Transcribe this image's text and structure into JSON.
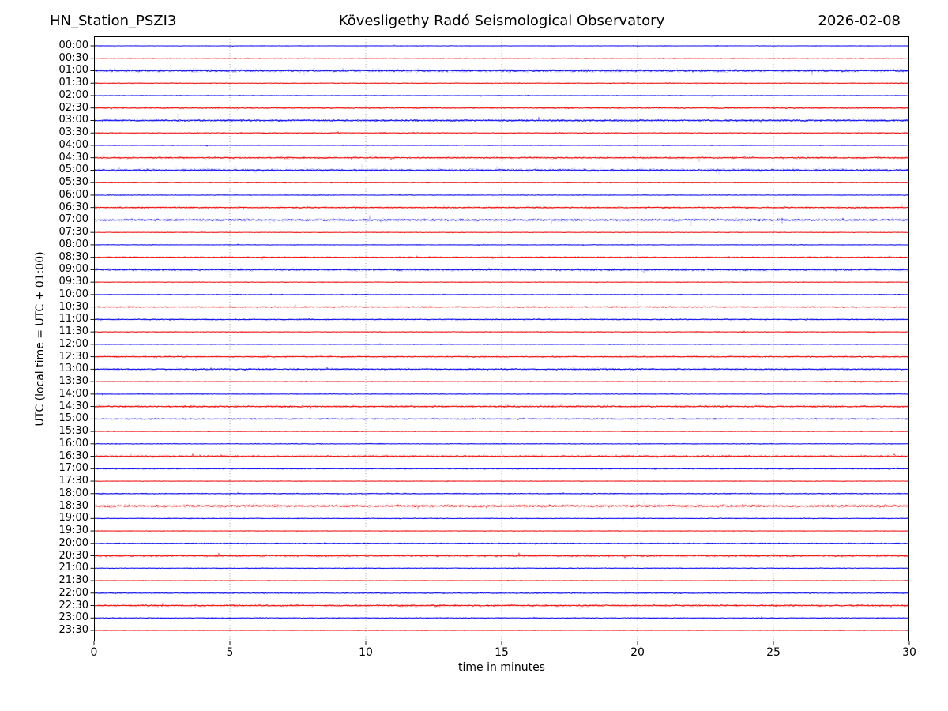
{
  "chart_data": {
    "type": "line",
    "subtype": "helicorder-dayplot",
    "title_left": "HN_Station_PSZI3",
    "title_center": "Kövesligethy Radó Seismological Observatory",
    "title_right": "2026-02-08",
    "ylabel": "UTC (local time = UTC + 01:00)",
    "xlabel": "time in minutes",
    "xlim": [
      0,
      30
    ],
    "x_ticks": [
      0,
      5,
      10,
      15,
      20,
      25,
      30
    ],
    "grid_vertical_minutes": [
      5,
      10,
      15,
      20,
      25
    ],
    "grid_style": "dotted gray vertical lines, no horizontal grid",
    "minutes_per_row": 30,
    "colors": {
      "blue": "#0000ee",
      "red": "#ee0000",
      "grid": "#666666",
      "frame": "#000000"
    },
    "rows": [
      {
        "t": "00:00",
        "c": "blue",
        "a": 0.55
      },
      {
        "t": "00:30",
        "c": "red",
        "a": 0.75
      },
      {
        "t": "01:00",
        "c": "blue",
        "a": 1.9
      },
      {
        "t": "01:30",
        "c": "red",
        "a": 0.75
      },
      {
        "t": "02:00",
        "c": "blue",
        "a": 0.65
      },
      {
        "t": "02:30",
        "c": "red",
        "a": 1.25
      },
      {
        "t": "03:00",
        "c": "blue",
        "a": 1.9
      },
      {
        "t": "03:30",
        "c": "red",
        "a": 0.85
      },
      {
        "t": "04:00",
        "c": "blue",
        "a": 0.65
      },
      {
        "t": "04:30",
        "c": "red",
        "a": 1.45
      },
      {
        "t": "05:00",
        "c": "blue",
        "a": 1.9
      },
      {
        "t": "05:30",
        "c": "red",
        "a": 0.75
      },
      {
        "t": "06:00",
        "c": "blue",
        "a": 0.75
      },
      {
        "t": "06:30",
        "c": "red",
        "a": 1.35
      },
      {
        "t": "07:00",
        "c": "blue",
        "a": 1.7
      },
      {
        "t": "07:30",
        "c": "red",
        "a": 0.65
      },
      {
        "t": "08:00",
        "c": "blue",
        "a": 0.65
      },
      {
        "t": "08:30",
        "c": "red",
        "a": 1.15
      },
      {
        "t": "09:00",
        "c": "blue",
        "a": 1.7
      },
      {
        "t": "09:30",
        "c": "red",
        "a": 0.65
      },
      {
        "t": "10:00",
        "c": "blue",
        "a": 0.75
      },
      {
        "t": "10:30",
        "c": "red",
        "a": 1.15
      },
      {
        "t": "11:00",
        "c": "blue",
        "a": 1.15
      },
      {
        "t": "11:30",
        "c": "red",
        "a": 0.75
      },
      {
        "t": "12:00",
        "c": "blue",
        "a": 0.65
      },
      {
        "t": "12:30",
        "c": "red",
        "a": 1.25
      },
      {
        "t": "13:00",
        "c": "blue",
        "a": 1.35
      },
      {
        "t": "13:30",
        "c": "red",
        "a": 0.65,
        "ev": {
          "m0": 26.8,
          "m1": 29.6,
          "a": 1.15
        }
      },
      {
        "t": "14:00",
        "c": "blue",
        "a": 0.75
      },
      {
        "t": "14:30",
        "c": "red",
        "a": 1.6
      },
      {
        "t": "15:00",
        "c": "blue",
        "a": 1.05
      },
      {
        "t": "15:30",
        "c": "red",
        "a": 0.65
      },
      {
        "t": "16:00",
        "c": "blue",
        "a": 0.75
      },
      {
        "t": "16:30",
        "c": "red",
        "a": 1.7
      },
      {
        "t": "17:00",
        "c": "blue",
        "a": 1.05
      },
      {
        "t": "17:30",
        "c": "red",
        "a": 0.65
      },
      {
        "t": "18:00",
        "c": "blue",
        "a": 0.95
      },
      {
        "t": "18:30",
        "c": "red",
        "a": 1.9
      },
      {
        "t": "19:00",
        "c": "blue",
        "a": 0.75
      },
      {
        "t": "19:30",
        "c": "red",
        "a": 0.65
      },
      {
        "t": "20:00",
        "c": "blue",
        "a": 0.95
      },
      {
        "t": "20:30",
        "c": "red",
        "a": 1.7
      },
      {
        "t": "21:00",
        "c": "blue",
        "a": 0.75
      },
      {
        "t": "21:30",
        "c": "red",
        "a": 0.65
      },
      {
        "t": "22:00",
        "c": "blue",
        "a": 1.05
      },
      {
        "t": "22:30",
        "c": "red",
        "a": 1.6
      },
      {
        "t": "23:00",
        "c": "blue",
        "a": 0.85
      },
      {
        "t": "23:30",
        "c": "red",
        "a": 0.65
      }
    ]
  }
}
